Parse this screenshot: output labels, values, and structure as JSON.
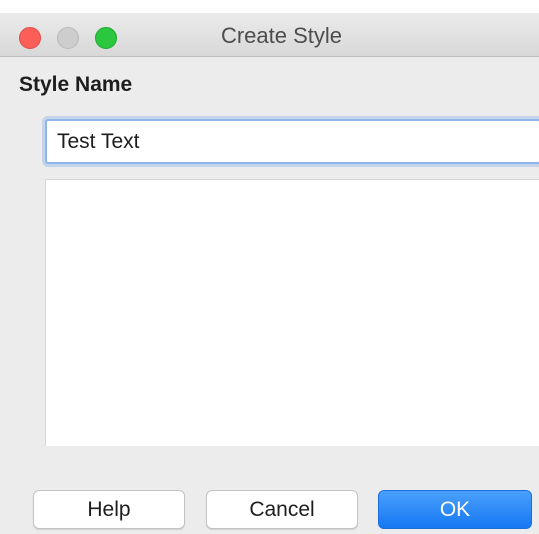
{
  "window": {
    "title": "Create Style",
    "controls": [
      {
        "name": "close",
        "color": "#fc5f57"
      },
      {
        "name": "minimize",
        "color": "#cdcdcd"
      },
      {
        "name": "zoom",
        "color": "#2ac73f"
      }
    ]
  },
  "form": {
    "section_label": "Style Name",
    "style_name_value": "Test Text"
  },
  "style_list": {
    "items": []
  },
  "buttons": {
    "help_label": "Help",
    "cancel_label": "Cancel",
    "ok_label": "OK"
  },
  "colors": {
    "accent": "#1678f3",
    "focus_ring": "#8fb6e8"
  }
}
